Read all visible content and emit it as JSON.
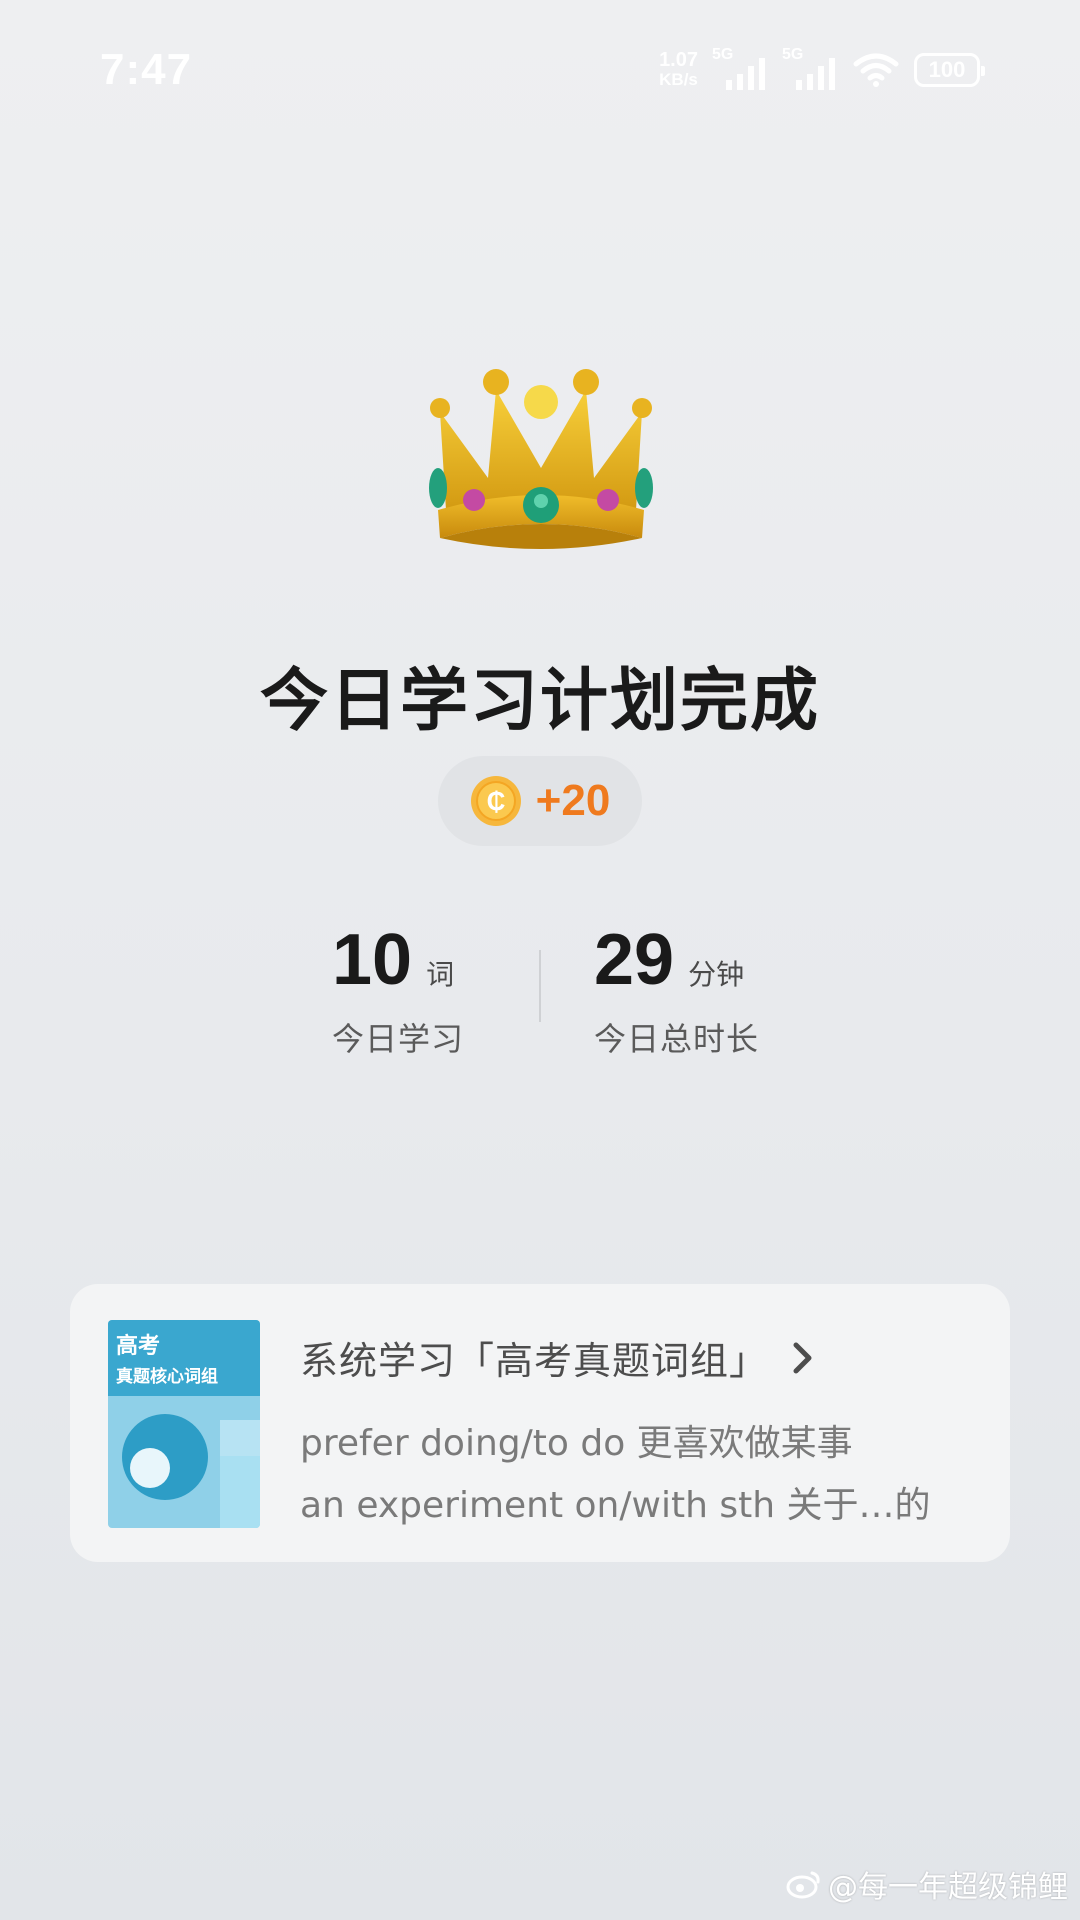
{
  "status_bar": {
    "time": "7:47",
    "net_speed_value": "1.07",
    "net_speed_unit": "KB/s",
    "sim1_tag": "5G",
    "sim2_tag": "5G",
    "battery": "100",
    "icons": [
      "signal-icon",
      "wifi-icon",
      "battery-icon"
    ]
  },
  "main": {
    "icon": "crown-icon",
    "title": "今日学习计划完成",
    "reward": {
      "icon": "coin-icon",
      "amount": "+20",
      "color": "#ef7a1e"
    },
    "stats": [
      {
        "value": "10",
        "unit": "词",
        "label": "今日学习"
      },
      {
        "value": "29",
        "unit": "分钟",
        "label": "今日总时长"
      }
    ]
  },
  "card": {
    "book_cover": {
      "title": "高考",
      "subtitle": "真题核心词组"
    },
    "title": "系统学习「高考真题词组」",
    "chevron": "chevron-right-icon",
    "lines": [
      "prefer doing/to do 更喜欢做某事",
      "an experiment on/with sth 关于…的"
    ]
  },
  "watermark": {
    "text": "@每一年超级锦鲤"
  }
}
